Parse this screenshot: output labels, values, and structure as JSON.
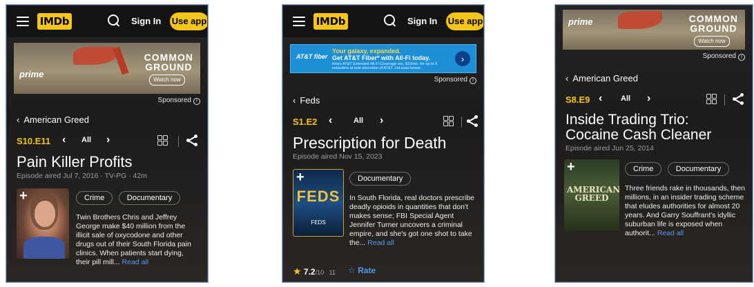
{
  "header": {
    "logo": "IMDb",
    "signin": "Sign In",
    "useapp": "Use app"
  },
  "ads": {
    "prime": {
      "brand": "prime",
      "title_line1": "COMMON",
      "title_line2": "GROUND",
      "cta": "Watch now"
    },
    "att": {
      "brand": "AT&T fiber",
      "headline1": "Your galaxy, expanded.",
      "headline2": "Get AT&T Fiber* with All-Fi today.",
      "fine": "Req's AT&T Extended Wi-Fi Coverage svc, $10/mo. for up to 5 extenders at sole discretion of AT&T. Ltd avail./areas."
    },
    "sponsored": "Sponsored"
  },
  "screens": [
    {
      "back_label": "American Greed",
      "episode_code": "S10.E11",
      "all_label": "All",
      "title": "Pain Killer Profits",
      "aired": "Episode aired Jul 7, 2016 · TV-PG · 42m",
      "genres": [
        "Crime",
        "Documentary"
      ],
      "description": "Twin Brothers Chris and Jeffrey George make $40 million from the illicit sale of oxycodone and other drugs out of their South Florida pain clinics. When patients start dying, their pill mill...",
      "read_all": "Read all"
    },
    {
      "back_label": "Feds",
      "episode_code": "S1.E2",
      "all_label": "All",
      "title": "Prescription for Death",
      "aired": "Episode aired Nov 15, 2023",
      "genres": [
        "Documentary"
      ],
      "poster_text": "FEDS",
      "poster_small": "FEDS",
      "description": "In South Florida, real doctors prescribe deadly opioids in quantities that don't makes sense; FBI Special Agent Jennifer Turner uncovers a criminal empire, and she's got one shot to take the...",
      "read_all": "Read all",
      "rating": "7.2",
      "rating_scale": "/10",
      "rating_count": "11",
      "rate_label": "Rate"
    },
    {
      "back_label": "American Greed",
      "episode_code": "S8.E9",
      "all_label": "All",
      "title": "Inside Trading Trio: Cocaine Cash Cleaner",
      "aired": "Episode aired Jun 25, 2014",
      "genres": [
        "Crime",
        "Documentary"
      ],
      "poster_text": "AMERICAN GREED",
      "description": "Three friends rake in thousands, then millions, in an insider trading scheme that eludes authorities for almost 20 years. And Garry Souffrant's idyllic suburban life is exposed when authorit...",
      "read_all": "Read all"
    }
  ],
  "colors": {
    "imdb_yellow": "#f5c518",
    "link_blue": "#5799ef",
    "background": "#1f1f1f"
  },
  "icons": [
    "menu-icon",
    "search-icon",
    "back-chevron-icon",
    "prev-episode-icon",
    "next-episode-icon",
    "episode-grid-icon",
    "share-icon",
    "add-watchlist-icon",
    "star-icon",
    "info-icon"
  ]
}
